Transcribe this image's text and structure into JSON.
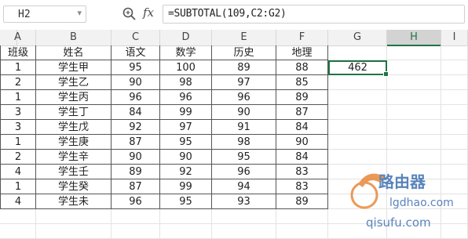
{
  "formula_bar": {
    "name_box": "H2",
    "fx_label": "fx",
    "formula": "=SUBTOTAL(109,C2:G2)"
  },
  "columns": [
    "A",
    "B",
    "C",
    "D",
    "E",
    "F",
    "G",
    "H",
    "I"
  ],
  "active_column": "H",
  "table": {
    "headers": [
      "班级",
      "姓名",
      "语文",
      "数学",
      "英语",
      "历史",
      "地理"
    ],
    "rows": [
      [
        "1",
        "学生甲",
        "95",
        "100",
        "89",
        "88"
      ],
      [
        "2",
        "学生乙",
        "90",
        "98",
        "97",
        "85"
      ],
      [
        "1",
        "学生丙",
        "96",
        "96",
        "96",
        "89"
      ],
      [
        "3",
        "学生丁",
        "84",
        "99",
        "90",
        "87"
      ],
      [
        "3",
        "学生戊",
        "92",
        "97",
        "91",
        "84"
      ],
      [
        "1",
        "学生庚",
        "87",
        "95",
        "98",
        "90"
      ],
      [
        "2",
        "学生辛",
        "90",
        "90",
        "95",
        "84"
      ],
      [
        "4",
        "学生壬",
        "89",
        "92",
        "96",
        "83"
      ],
      [
        "1",
        "学生癸",
        "87",
        "99",
        "94",
        "83"
      ],
      [
        "4",
        "学生未",
        "96",
        "95",
        "93",
        "89"
      ]
    ]
  },
  "selected_cell": {
    "ref": "H2",
    "value": "462"
  },
  "watermark": {
    "line1": "路由器",
    "line2": "lgdhao.com",
    "line3": "qisufu.com"
  },
  "colors": {
    "accent": "#217346",
    "header_bg": "#f2f2f2",
    "active_header_bg": "#d3d3d3"
  }
}
